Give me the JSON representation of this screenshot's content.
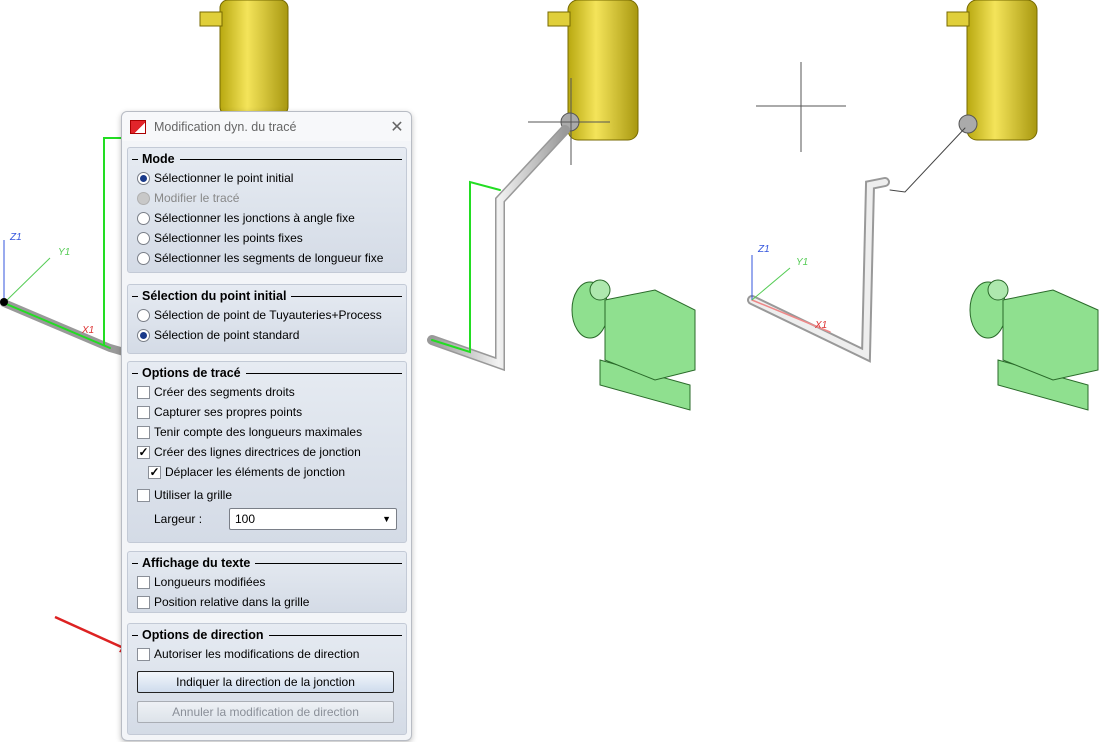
{
  "viewport": {
    "axes": [
      {
        "z": "Z1",
        "y": "Y1",
        "x": "X1"
      },
      {
        "z": "Z1",
        "y": "Y1",
        "x": "X1"
      }
    ]
  },
  "dialog": {
    "title": "Modification dyn. du tracé",
    "mode": {
      "legend": "Mode",
      "options": [
        {
          "label": "Sélectionner le point initial",
          "selected": true,
          "enabled": true
        },
        {
          "label": "Modifier le tracé",
          "selected": false,
          "enabled": false
        },
        {
          "label": "Sélectionner les jonctions à angle fixe",
          "selected": false,
          "enabled": true
        },
        {
          "label": "Sélectionner les points fixes",
          "selected": false,
          "enabled": true
        },
        {
          "label": "Sélectionner les segments de longueur fixe",
          "selected": false,
          "enabled": true
        }
      ]
    },
    "initial_point": {
      "legend": "Sélection du point initial",
      "options": [
        {
          "label": "Sélection de point de Tuyauteries+Process",
          "selected": false
        },
        {
          "label": "Sélection de point standard",
          "selected": true
        }
      ]
    },
    "trace_options": {
      "legend": "Options de tracé",
      "items": [
        {
          "label": "Créer des segments droits",
          "checked": false
        },
        {
          "label": "Capturer ses propres points",
          "checked": false
        },
        {
          "label": "Tenir compte des longueurs maximales",
          "checked": false
        },
        {
          "label": "Créer des lignes directrices de jonction",
          "checked": true
        },
        {
          "label": "Déplacer les éléments de jonction",
          "checked": true
        },
        {
          "label": "Utiliser la grille",
          "checked": false
        }
      ],
      "width_label": "Largeur :",
      "width_value": "100"
    },
    "text_display": {
      "legend": "Affichage du texte",
      "items": [
        {
          "label": "Longueurs modifiées",
          "checked": false
        },
        {
          "label": "Position relative dans la grille",
          "checked": false
        }
      ]
    },
    "direction": {
      "legend": "Options de direction",
      "allow_label": "Autoriser les modifications de direction",
      "allow_checked": false,
      "indicate_button": "Indiquer la direction de la jonction",
      "cancel_button": "Annuler la modification de direction"
    }
  },
  "colors": {
    "tank": "#d9c72a",
    "pump": "#8fe08f",
    "pipe_selected": "#22dd22",
    "arrow": "#d22"
  }
}
